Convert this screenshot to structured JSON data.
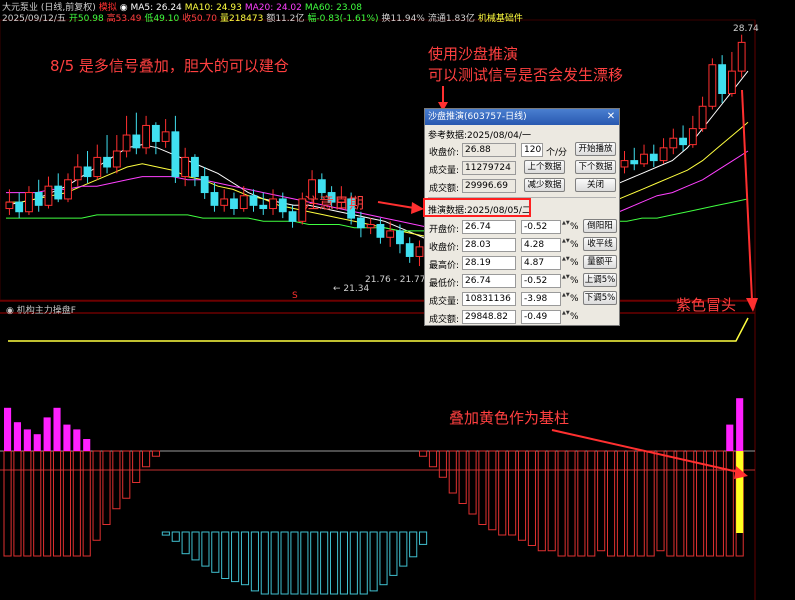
{
  "header": {
    "line1": [
      {
        "text": "大元泵业 (日线,前复权)",
        "color": "#d0d0d0"
      },
      {
        "text": "模拟",
        "color": "#ff3030"
      },
      {
        "text": "◉ MA5: 26.24",
        "color": "#ffffff"
      },
      {
        "text": "MA10: 24.93",
        "color": "#ffff40"
      },
      {
        "text": "MA20: 24.02",
        "color": "#ff40ff"
      },
      {
        "text": "MA60: 23.08",
        "color": "#40ff40"
      }
    ],
    "line2": [
      {
        "text": "2025/09/12/五",
        "color": "#d0d0d0"
      },
      {
        "text": "开50.98",
        "color": "#40ff40"
      },
      {
        "text": "高53.49",
        "color": "#ff4040"
      },
      {
        "text": "低49.10",
        "color": "#40ff40"
      },
      {
        "text": "收50.70",
        "color": "#ff4040"
      },
      {
        "text": "量218473",
        "color": "#ffff40"
      },
      {
        "text": "额11.2亿",
        "color": "#d0d0d0"
      },
      {
        "text": "幅-0.83(-1.61%)",
        "color": "#40ff40"
      },
      {
        "text": "换11.94%",
        "color": "#d0d0d0"
      },
      {
        "text": "流通1.83亿",
        "color": "#d0d0d0"
      },
      {
        "text": "机械基础件",
        "color": "#ffff40"
      }
    ]
  },
  "price_labels": {
    "high": "28.74",
    "low": "21.34",
    "mid": "21.76 - 21.77",
    "marker": "S"
  },
  "sub_title": "◉ 机构主力操盘F",
  "annotations": {
    "signal": "8/5 是多信号叠加，胆大的可以建仓",
    "sandbox_line1": "使用沙盘推演",
    "sandbox_line2": "可以测试信号是否会发生漂移",
    "date_note": "注意日期",
    "purple": "紫色冒头",
    "yellow": "叠加黄色作为基柱"
  },
  "dialog": {
    "title": "沙盘推演(603757-日线)",
    "ref_label": "参考数据:2025/08/04/一",
    "close_label": "收盘价:",
    "close_value": "26.88",
    "days_value": "120",
    "days_unit": "个/分",
    "start_btn": "开始播放",
    "vol_label": "成交量:",
    "vol_value": "11279724",
    "prev_btn": "上个数据",
    "next_btn": "下个数据",
    "amt_label": "成交额:",
    "amt_value": "29996.69",
    "reduce_btn": "减少数据",
    "close_btn": "关闭",
    "sim_label": "推演数据:2025/08/05/二",
    "rows": [
      {
        "label": "开盘价:",
        "value": "26.74",
        "pct": "-0.52",
        "btn": "倒阳阳"
      },
      {
        "label": "收盘价:",
        "value": "28.03",
        "pct": "4.28",
        "btn": "收平线"
      },
      {
        "label": "最高价:",
        "value": "28.19",
        "pct": "4.87",
        "btn": "量额平"
      },
      {
        "label": "最低价:",
        "value": "26.74",
        "pct": "-0.52",
        "btn": "上调5%"
      },
      {
        "label": "成交量:",
        "value": "10831136",
        "pct": "-3.98",
        "btn": "下调5%"
      },
      {
        "label": "成交额:",
        "value": "29848.82",
        "pct": "-0.49",
        "btn": ""
      }
    ],
    "pct_unit": "%"
  },
  "colors": {
    "up": "#ff3030",
    "down": "#40e0f0",
    "ma5": "#ffffff",
    "ma10": "#ffff40",
    "ma20": "#ff40ff",
    "ma60": "#40ff40",
    "annotation": "#ff4040",
    "highlight": "#ff2020"
  },
  "candles": [
    {
      "o": 23.3,
      "c": 23.5,
      "h": 23.9,
      "l": 23.1
    },
    {
      "o": 23.5,
      "c": 23.2,
      "h": 23.8,
      "l": 23.0
    },
    {
      "o": 23.2,
      "c": 23.8,
      "h": 24.0,
      "l": 23.1
    },
    {
      "o": 23.8,
      "c": 23.4,
      "h": 24.2,
      "l": 23.2
    },
    {
      "o": 23.4,
      "c": 24.0,
      "h": 24.3,
      "l": 23.3
    },
    {
      "o": 24.0,
      "c": 23.6,
      "h": 24.4,
      "l": 23.5
    },
    {
      "o": 23.6,
      "c": 24.2,
      "h": 24.4,
      "l": 23.5
    },
    {
      "o": 24.2,
      "c": 24.6,
      "h": 25.0,
      "l": 24.0
    },
    {
      "o": 24.6,
      "c": 24.3,
      "h": 25.1,
      "l": 24.1
    },
    {
      "o": 24.3,
      "c": 24.9,
      "h": 25.3,
      "l": 24.2
    },
    {
      "o": 24.9,
      "c": 24.6,
      "h": 25.6,
      "l": 24.4
    },
    {
      "o": 24.6,
      "c": 25.1,
      "h": 25.6,
      "l": 24.4
    },
    {
      "o": 25.1,
      "c": 25.6,
      "h": 26.2,
      "l": 24.9
    },
    {
      "o": 25.6,
      "c": 25.2,
      "h": 26.3,
      "l": 25.0
    },
    {
      "o": 25.2,
      "c": 25.9,
      "h": 26.2,
      "l": 25.0
    },
    {
      "o": 25.9,
      "c": 25.4,
      "h": 26.0,
      "l": 25.0
    },
    {
      "o": 25.4,
      "c": 25.7,
      "h": 26.1,
      "l": 25.2
    },
    {
      "o": 25.7,
      "c": 24.3,
      "h": 26.2,
      "l": 24.1
    },
    {
      "o": 24.3,
      "c": 24.9,
      "h": 25.2,
      "l": 24.0
    },
    {
      "o": 24.9,
      "c": 24.3,
      "h": 25.0,
      "l": 24.0
    },
    {
      "o": 24.3,
      "c": 23.8,
      "h": 24.6,
      "l": 23.6
    },
    {
      "o": 23.8,
      "c": 23.4,
      "h": 24.1,
      "l": 23.2
    },
    {
      "o": 23.4,
      "c": 23.6,
      "h": 23.9,
      "l": 23.2
    },
    {
      "o": 23.6,
      "c": 23.3,
      "h": 23.8,
      "l": 23.1
    },
    {
      "o": 23.3,
      "c": 23.7,
      "h": 24.0,
      "l": 23.2
    },
    {
      "o": 23.7,
      "c": 23.4,
      "h": 23.9,
      "l": 23.2
    },
    {
      "o": 23.4,
      "c": 23.3,
      "h": 23.8,
      "l": 23.1
    },
    {
      "o": 23.3,
      "c": 23.6,
      "h": 23.9,
      "l": 23.1
    },
    {
      "o": 23.6,
      "c": 23.2,
      "h": 23.8,
      "l": 23.0
    },
    {
      "o": 23.2,
      "c": 22.9,
      "h": 23.4,
      "l": 22.7
    },
    {
      "o": 22.9,
      "c": 23.6,
      "h": 23.8,
      "l": 22.8
    },
    {
      "o": 23.6,
      "c": 24.2,
      "h": 24.5,
      "l": 23.5
    },
    {
      "o": 24.2,
      "c": 23.8,
      "h": 24.4,
      "l": 23.6
    },
    {
      "o": 23.8,
      "c": 23.5,
      "h": 24.0,
      "l": 23.3
    },
    {
      "o": 23.5,
      "c": 23.6,
      "h": 24.0,
      "l": 23.3
    },
    {
      "o": 23.6,
      "c": 23.0,
      "h": 23.8,
      "l": 22.8
    },
    {
      "o": 23.0,
      "c": 22.7,
      "h": 23.2,
      "l": 22.4
    },
    {
      "o": 22.7,
      "c": 22.8,
      "h": 23.0,
      "l": 22.5
    },
    {
      "o": 22.8,
      "c": 22.4,
      "h": 23.0,
      "l": 22.2
    },
    {
      "o": 22.4,
      "c": 22.6,
      "h": 22.9,
      "l": 22.1
    },
    {
      "o": 22.6,
      "c": 22.2,
      "h": 22.8,
      "l": 21.9
    },
    {
      "o": 22.2,
      "c": 21.8,
      "h": 22.4,
      "l": 21.6
    },
    {
      "o": 21.8,
      "c": 22.1,
      "h": 22.3,
      "l": 21.5
    },
    {
      "o": 22.1,
      "c": 21.9,
      "h": 22.4,
      "l": 21.6
    },
    {
      "o": 21.9,
      "c": 21.6,
      "h": 22.0,
      "l": 21.34
    },
    {
      "o": 21.6,
      "c": 22.0,
      "h": 22.2,
      "l": 21.5
    },
    {
      "o": 22.0,
      "c": 21.8,
      "h": 22.2,
      "l": 21.6
    },
    {
      "o": 21.8,
      "c": 22.1,
      "h": 22.3,
      "l": 21.7
    },
    {
      "o": 22.1,
      "c": 22.5,
      "h": 22.7,
      "l": 21.9
    },
    {
      "o": 22.5,
      "c": 22.3,
      "h": 22.8,
      "l": 22.1
    },
    {
      "o": 22.3,
      "c": 22.8,
      "h": 23.0,
      "l": 22.2
    },
    {
      "o": 22.8,
      "c": 23.2,
      "h": 23.5,
      "l": 22.7
    },
    {
      "o": 23.2,
      "c": 23.0,
      "h": 23.4,
      "l": 22.8
    },
    {
      "o": 23.0,
      "c": 23.4,
      "h": 23.6,
      "l": 22.9
    },
    {
      "o": 23.4,
      "c": 23.8,
      "h": 24.0,
      "l": 23.2
    },
    {
      "o": 23.8,
      "c": 24.1,
      "h": 24.3,
      "l": 23.6
    },
    {
      "o": 24.1,
      "c": 24.0,
      "h": 24.4,
      "l": 23.8
    },
    {
      "o": 24.0,
      "c": 24.3,
      "h": 24.5,
      "l": 23.9
    },
    {
      "o": 24.3,
      "c": 24.1,
      "h": 24.6,
      "l": 24.0
    },
    {
      "o": 24.1,
      "c": 24.4,
      "h": 24.7,
      "l": 24.0
    },
    {
      "o": 24.4,
      "c": 24.5,
      "h": 24.8,
      "l": 24.2
    },
    {
      "o": 24.5,
      "c": 24.3,
      "h": 24.9,
      "l": 24.1
    },
    {
      "o": 24.3,
      "c": 24.6,
      "h": 24.9,
      "l": 24.2
    },
    {
      "o": 24.6,
      "c": 24.8,
      "h": 25.1,
      "l": 24.4
    },
    {
      "o": 24.8,
      "c": 24.7,
      "h": 25.2,
      "l": 24.5
    },
    {
      "o": 24.7,
      "c": 25.0,
      "h": 25.3,
      "l": 24.6
    },
    {
      "o": 25.0,
      "c": 24.8,
      "h": 25.3,
      "l": 24.6
    },
    {
      "o": 24.8,
      "c": 25.2,
      "h": 25.5,
      "l": 24.7
    },
    {
      "o": 25.2,
      "c": 25.5,
      "h": 25.8,
      "l": 25.0
    },
    {
      "o": 25.5,
      "c": 25.3,
      "h": 25.9,
      "l": 25.1
    },
    {
      "o": 25.3,
      "c": 25.8,
      "h": 26.2,
      "l": 25.2
    },
    {
      "o": 25.8,
      "c": 26.5,
      "h": 26.8,
      "l": 25.7
    },
    {
      "o": 26.5,
      "c": 27.8,
      "h": 28.0,
      "l": 26.4
    },
    {
      "o": 27.8,
      "c": 26.9,
      "h": 28.1,
      "l": 26.6
    },
    {
      "o": 26.9,
      "c": 27.6,
      "h": 28.2,
      "l": 26.8
    },
    {
      "o": 27.6,
      "c": 28.5,
      "h": 28.74,
      "l": 27.4
    }
  ],
  "ma_lines": {
    "ma5": [
      23.4,
      23.5,
      23.6,
      23.8,
      24.0,
      24.3,
      24.6,
      24.9,
      25.2,
      25.3,
      25.2,
      25.0,
      24.8,
      24.6,
      24.4,
      24.1,
      23.8,
      23.6,
      23.5,
      23.4,
      23.4,
      23.3,
      23.2,
      23.1,
      23.0,
      22.9,
      22.7,
      22.5,
      22.3,
      22.1,
      22.0,
      21.9,
      21.9,
      22.0,
      22.2,
      22.5,
      22.8,
      23.1,
      23.4,
      23.7,
      24.0,
      24.2,
      24.4,
      24.6,
      24.8,
      25.2,
      25.8,
      26.4,
      27.0,
      27.6
    ],
    "ma10": [
      23.5,
      23.5,
      23.6,
      23.7,
      23.8,
      24.0,
      24.2,
      24.4,
      24.6,
      24.7,
      24.6,
      24.5,
      24.3,
      24.2,
      24.0,
      23.9,
      23.7,
      23.6,
      23.4,
      23.3,
      23.2,
      23.1,
      23.0,
      22.9,
      22.8,
      22.7,
      22.6,
      22.5,
      22.4,
      22.3,
      22.2,
      22.1,
      22.1,
      22.1,
      22.2,
      22.3,
      22.5,
      22.7,
      23.0,
      23.2,
      23.5,
      23.7,
      23.9,
      24.1,
      24.3,
      24.5,
      24.8,
      25.2,
      25.6,
      26.0
    ],
    "ma20": [
      23.8,
      23.8,
      23.8,
      23.9,
      23.9,
      24.0,
      24.0,
      24.1,
      24.2,
      24.3,
      24.3,
      24.3,
      24.2,
      24.2,
      24.1,
      24.0,
      23.9,
      23.8,
      23.7,
      23.6,
      23.5,
      23.4,
      23.3,
      23.2,
      23.1,
      23.0,
      22.9,
      22.8,
      22.7,
      22.6,
      22.5,
      22.5,
      22.4,
      22.4,
      22.4,
      22.5,
      22.5,
      22.6,
      22.8,
      22.9,
      23.1,
      23.3,
      23.5,
      23.7,
      23.8,
      24.0,
      24.2,
      24.5,
      24.8,
      25.1
    ],
    "ma60": [
      23.0,
      23.0,
      23.0,
      23.0,
      23.0,
      23.0,
      23.1,
      23.1,
      23.1,
      23.1,
      23.1,
      23.1,
      23.1,
      23.0,
      23.0,
      23.0,
      23.0,
      22.9,
      22.9,
      22.9,
      22.8,
      22.8,
      22.8,
      22.7,
      22.7,
      22.7,
      22.6,
      22.6,
      22.6,
      22.6,
      22.6,
      22.6,
      22.6,
      22.6,
      22.6,
      22.7,
      22.7,
      22.7,
      22.8,
      22.8,
      22.9,
      22.9,
      23.0,
      23.0,
      23.1,
      23.2,
      23.3,
      23.4,
      23.5,
      23.6
    ]
  },
  "chart_data": {
    "type": "bar",
    "title": "机构主力操盘F",
    "series": [
      {
        "name": "purple",
        "values": [
          0.9,
          0.6,
          0.45,
          0.35,
          0.7,
          0.9,
          0.55,
          0.45,
          0.25,
          0,
          0,
          0,
          0,
          0,
          0,
          0,
          0,
          0,
          0,
          0,
          0,
          0,
          0,
          0,
          0,
          0,
          0,
          0,
          0,
          0,
          0,
          0,
          0,
          0,
          0,
          0,
          0,
          0,
          0,
          0,
          0,
          0,
          0,
          0,
          0,
          0,
          0,
          0,
          0,
          0,
          0,
          0,
          0,
          0,
          0,
          0,
          0,
          0,
          0,
          0,
          0,
          0,
          0,
          0,
          0,
          0,
          0,
          0,
          0,
          0,
          0,
          0,
          0,
          0.55,
          1.1
        ]
      },
      {
        "name": "red",
        "values": [
          1.0,
          1.0,
          1.0,
          1.0,
          1.0,
          1.0,
          1.0,
          1.0,
          1.0,
          0.85,
          0.7,
          0.55,
          0.45,
          0.3,
          0.15,
          0.05,
          0,
          0,
          0,
          0,
          0,
          0,
          0,
          0,
          0,
          0,
          0,
          0,
          0,
          0,
          0,
          0,
          0,
          0,
          0,
          0,
          0,
          0,
          0,
          0,
          0,
          0,
          0.05,
          0.15,
          0.25,
          0.4,
          0.5,
          0.6,
          0.7,
          0.75,
          0.8,
          0.8,
          0.85,
          0.9,
          0.95,
          0.95,
          1.0,
          1.0,
          1.0,
          1.0,
          0.95,
          1.0,
          1.0,
          1.0,
          1.0,
          1.0,
          0.95,
          1.0,
          1.0,
          1.0,
          1.0,
          1.0,
          1.0,
          1.0,
          1.0
        ]
      },
      {
        "name": "cyan",
        "values": [
          0,
          0,
          0,
          0,
          0,
          0,
          0,
          0,
          0,
          0,
          0,
          0,
          0,
          0,
          0,
          0,
          -0.05,
          -0.15,
          -0.35,
          -0.45,
          -0.55,
          -0.65,
          -0.75,
          -0.8,
          -0.85,
          -0.95,
          -1.0,
          -1.0,
          -1.0,
          -1.0,
          -1.0,
          -1.0,
          -1.0,
          -1.0,
          -1.0,
          -1.0,
          -1.0,
          -0.95,
          -0.85,
          -0.7,
          -0.55,
          -0.4,
          -0.2,
          0,
          0,
          0,
          0,
          0,
          0,
          0,
          0,
          0,
          0,
          0,
          0,
          0,
          0,
          0,
          0,
          0,
          0,
          0,
          0,
          0,
          0,
          0,
          0,
          0,
          0,
          0,
          0,
          0,
          0,
          0,
          0
        ]
      },
      {
        "name": "yellow",
        "values": [
          0,
          0,
          0,
          0,
          0,
          0,
          0,
          0,
          0,
          0,
          0,
          0,
          0,
          0,
          0,
          0,
          0,
          0,
          0,
          0,
          0,
          0,
          0,
          0,
          0,
          0,
          0,
          0,
          0,
          0,
          0,
          0,
          0,
          0,
          0,
          0,
          0,
          0,
          0,
          0,
          0,
          0,
          0,
          0,
          0,
          0,
          0,
          0,
          0,
          0,
          0,
          0,
          0,
          0,
          0,
          0,
          0,
          0,
          0,
          0,
          0,
          0,
          0,
          0,
          0,
          0,
          0,
          0,
          0,
          0,
          0,
          0,
          0,
          0,
          1.0
        ]
      }
    ]
  }
}
